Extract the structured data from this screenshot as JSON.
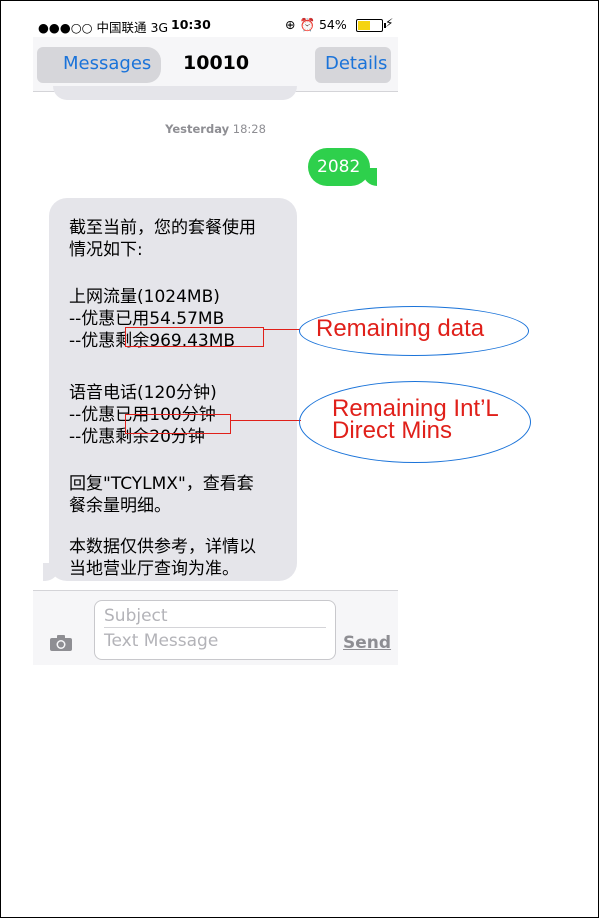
{
  "status_bar": {
    "carrier": "●●●○○ 中国联通  3G",
    "time": "10:30",
    "indicators": "⊕ ⏰ 54%",
    "battery_percent": 54
  },
  "nav": {
    "back_label": "Messages",
    "title": "10010",
    "details_label": "Details"
  },
  "thread": {
    "timestamp_day": "Yesterday",
    "timestamp_time": "18:28",
    "sent_message": "2082",
    "received_lines": [
      "截至当前，您的套餐使用",
      "情况如下:",
      "上网流量(1024MB)",
      "--优惠已用54.57MB",
      "--优惠剩余969.43MB",
      "语音电话(120分钟)",
      "--优惠已用100分钟",
      "--优惠剩余20分钟",
      "回复\"TCYLMX\"，查看套",
      "餐余量明细。",
      "本数据仅供参考，详情以",
      "当地营业厅查询为准。"
    ]
  },
  "composer": {
    "subject_placeholder": "Subject",
    "text_placeholder": "Text Message",
    "send_label": "Send"
  },
  "annotations": {
    "data_label": "Remaining data",
    "mins_label_1": "Remaining Int’L",
    "mins_label_2": "Direct Mins",
    "highlight_color": "#e0201a",
    "ellipse_color": "#1a73d9"
  }
}
